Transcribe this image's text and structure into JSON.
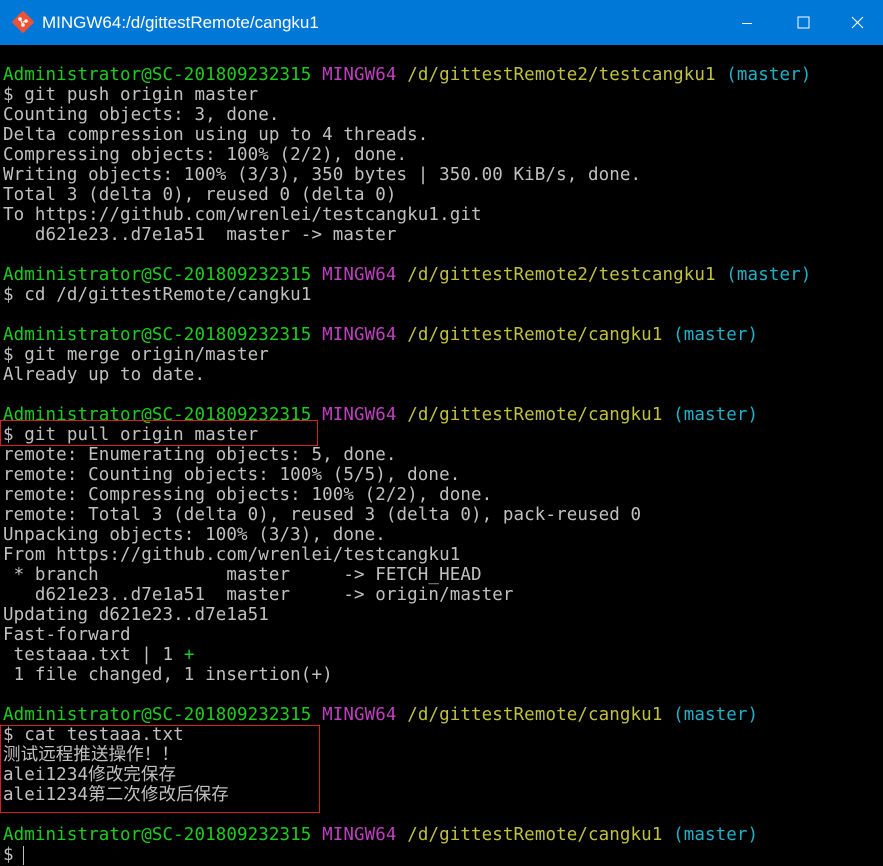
{
  "window": {
    "title": "MINGW64:/d/gittestRemote/cangku1",
    "icon": "git-icon",
    "controls": [
      "minimize-icon",
      "maximize-icon",
      "close-icon"
    ]
  },
  "prompt": {
    "user_host": "Administrator@SC-201809232315",
    "shell": "MINGW64",
    "path_remote2": "/d/gittestRemote2/testcangku1",
    "path_remote": "/d/gittestRemote/cangku1",
    "branch": "(master)",
    "symbol": "$ "
  },
  "lines": {
    "l01_cmd": "git push origin master",
    "l02": "Counting objects: 3, done.",
    "l03": "Delta compression using up to 4 threads.",
    "l04": "Compressing objects: 100% (2/2), done.",
    "l05": "Writing objects: 100% (3/3), 350 bytes | 350.00 KiB/s, done.",
    "l06": "Total 3 (delta 0), reused 0 (delta 0)",
    "l07": "To https://github.com/wrenlei/testcangku1.git",
    "l08": "   d621e23..d7e1a51  master -> master",
    "l10_cmd": "cd /d/gittestRemote/cangku1",
    "l12_cmd": "git merge origin/master",
    "l13": "Already up to date.",
    "l15_cmd": "git pull origin master",
    "l16": "remote: Enumerating objects: 5, done.",
    "l17": "remote: Counting objects: 100% (5/5), done.",
    "l18": "remote: Compressing objects: 100% (2/2), done.",
    "l19": "remote: Total 3 (delta 0), reused 3 (delta 0), pack-reused 0",
    "l20": "Unpacking objects: 100% (3/3), done.",
    "l21": "From https://github.com/wrenlei/testcangku1",
    "l22": " * branch            master     -> FETCH_HEAD",
    "l23": "   d621e23..d7e1a51  master     -> origin/master",
    "l24": "Updating d621e23..d7e1a51",
    "l25": "Fast-forward",
    "l26": " testaaa.txt | 1 ",
    "l26_plus": "+",
    "l27": " 1 file changed, 1 insertion(+)",
    "l29_cmd": "cat testaaa.txt",
    "l30": "测试远程推送操作！！",
    "l31_a": "alei1234",
    "l31_b": "修改完保存",
    "l32_a": "alei1234",
    "l32_b": "第二次修改后保存"
  },
  "colors": {
    "titlebar": "#0078d7",
    "user_host": "#1dcd1d",
    "shell": "#bf3fbf",
    "path": "#c0c03f",
    "branch": "#20b0c8",
    "text": "#c0c0c0",
    "highlight_box": "#d02020"
  }
}
